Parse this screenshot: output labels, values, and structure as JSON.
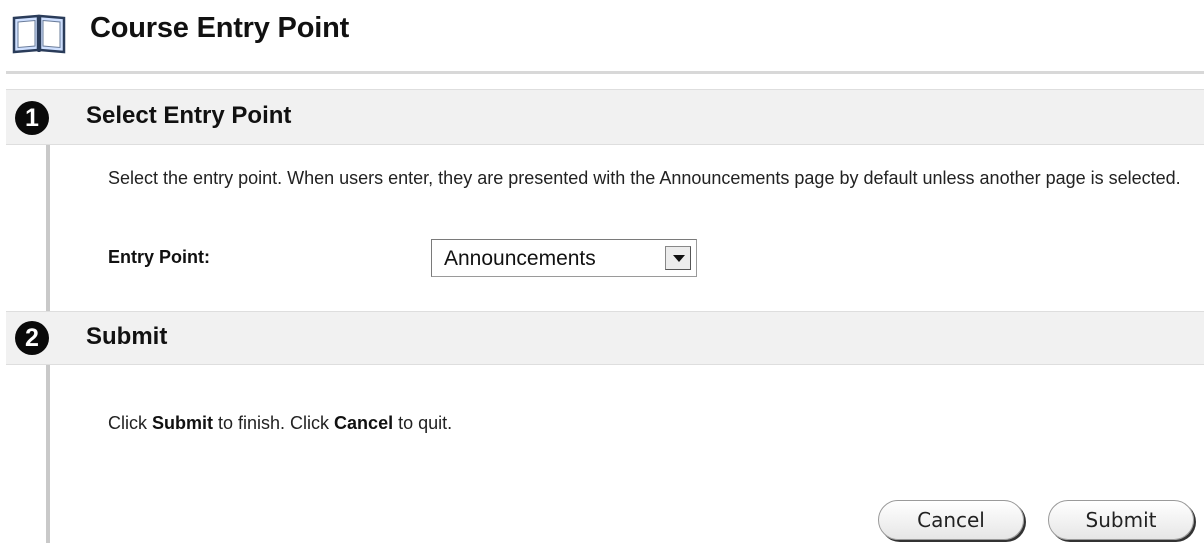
{
  "page": {
    "title": "Course Entry Point",
    "icon": "book-icon"
  },
  "steps": [
    {
      "number": "1",
      "title": "Select Entry Point"
    },
    {
      "number": "2",
      "title": "Submit"
    }
  ],
  "entry_section": {
    "instructions": "Select the entry point. When users enter, they are presented with the Announcements page by default unless another page is selected.",
    "field_label": "Entry Point:",
    "selected_value": "Announcements"
  },
  "submit_section": {
    "text_part1": "Click ",
    "text_bold1": "Submit",
    "text_part2": " to finish. Click ",
    "text_bold2": "Cancel",
    "text_part3": " to quit."
  },
  "buttons": {
    "cancel_label": "Cancel",
    "submit_label": "Submit"
  },
  "colors": {
    "step_bar_bg": "#f1f1f1",
    "step_number_bg": "#0a0a0a",
    "rule": "#d8d8d8"
  }
}
